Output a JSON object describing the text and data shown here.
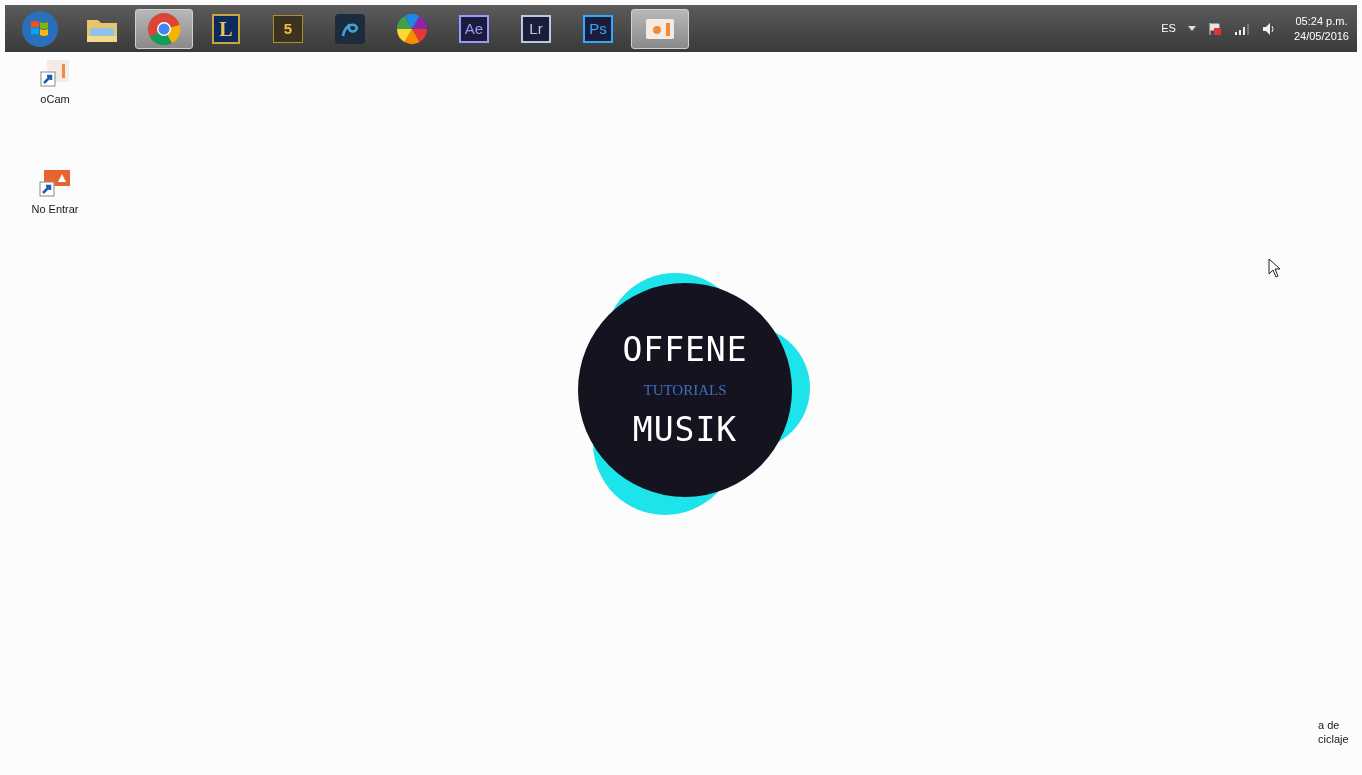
{
  "taskbar": {
    "items": [
      {
        "kind": "start",
        "active": false
      },
      {
        "kind": "folder",
        "active": false
      },
      {
        "kind": "chrome",
        "active": true
      },
      {
        "kind": "letter-gold",
        "label": "L",
        "active": false
      },
      {
        "kind": "game",
        "label": "5",
        "active": false
      },
      {
        "kind": "swirl",
        "active": false
      },
      {
        "kind": "colorwheel",
        "active": false
      },
      {
        "kind": "app",
        "label": "Ae",
        "color": "#9999ff",
        "active": false
      },
      {
        "kind": "app",
        "label": "Lr",
        "color": "#b4cbe0",
        "active": false
      },
      {
        "kind": "app",
        "label": "Ps",
        "color": "#31a8ff",
        "active": false
      },
      {
        "kind": "camera",
        "active": true
      }
    ],
    "tray": {
      "language": "ES",
      "time": "05:24 p.m.",
      "date": "24/05/2016"
    }
  },
  "desktop_icons": [
    {
      "kind": "ocam",
      "label": "oCam"
    },
    {
      "kind": "sign",
      "label": "No Entrar"
    }
  ],
  "partial_label": [
    "a de",
    "ciclaje"
  ],
  "logo": {
    "line_1": "OFFENE",
    "line_2": "TUTORIALS",
    "line_3": "MUSIK"
  }
}
